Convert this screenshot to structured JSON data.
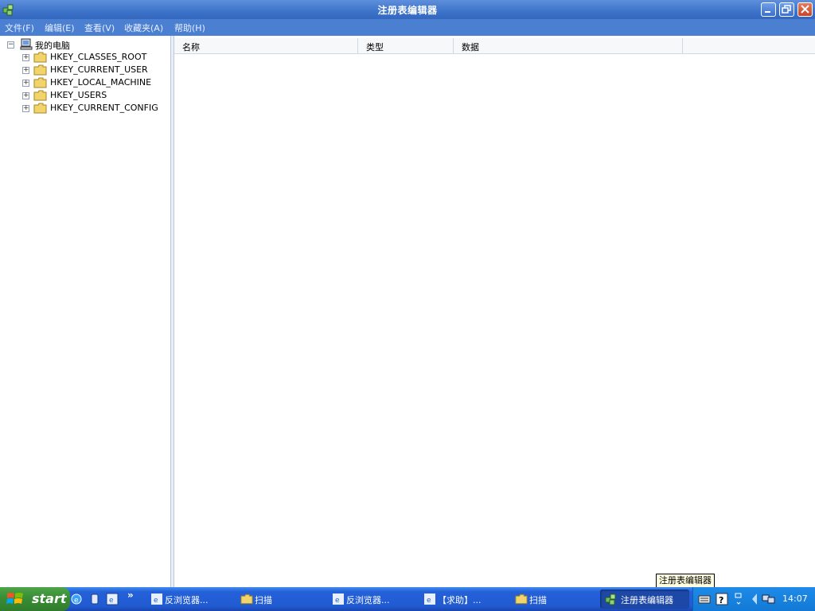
{
  "window": {
    "title": "注册表编辑器"
  },
  "menu": {
    "file": "文件(F)",
    "edit": "编辑(E)",
    "view": "查看(V)",
    "favorites": "收藏夹(A)",
    "help": "帮助(H)"
  },
  "tree": {
    "root": "我的电脑",
    "items": [
      "HKEY_CLASSES_ROOT",
      "HKEY_CURRENT_USER",
      "HKEY_LOCAL_MACHINE",
      "HKEY_USERS",
      "HKEY_CURRENT_CONFIG"
    ]
  },
  "list": {
    "columns": [
      "名称",
      "类型",
      "数据"
    ]
  },
  "tooltip": "注册表编辑器",
  "taskbar": {
    "start_label": "start",
    "tasks": [
      "反浏览器...",
      "扫描",
      "反浏览器...",
      "【求助】...",
      "扫描",
      "注册表编辑器"
    ],
    "clock": "14:07"
  },
  "colors": {
    "titlebar": "#3d73c9",
    "menubar": "#4a7fd2",
    "taskbar": "#215bd2",
    "start": "#3a8f36"
  },
  "icons": {
    "app": "registry-editor-icon",
    "computer": "computer-icon",
    "folder": "folder-icon"
  }
}
